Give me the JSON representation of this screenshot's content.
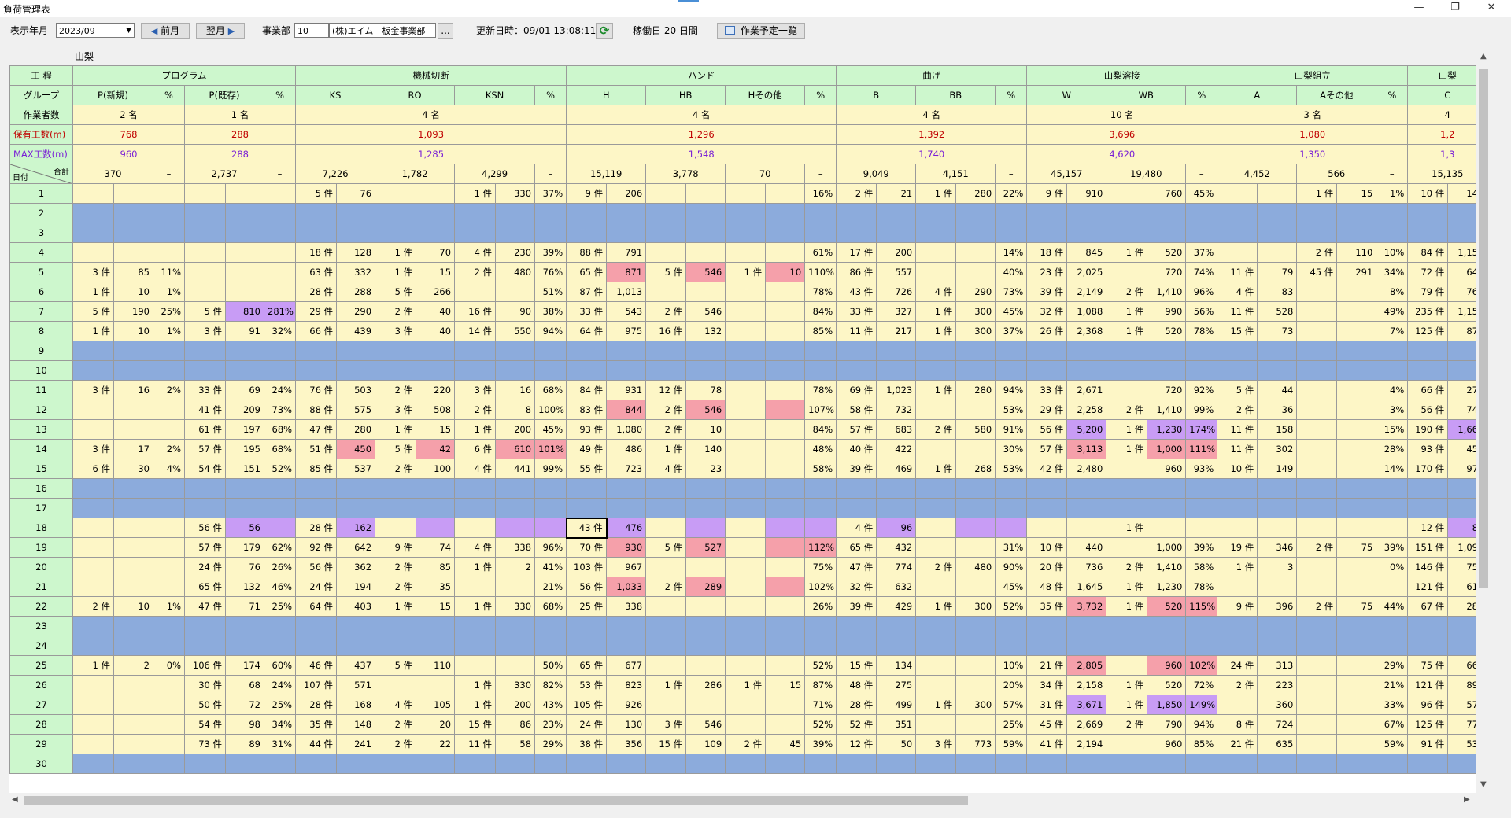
{
  "window": {
    "title": "負荷管理表",
    "btn_minimize": "—",
    "btn_maximize": "❐",
    "btn_close": "✕"
  },
  "toolbar": {
    "year_month_label": "表示年月",
    "year_month_value": "2023/09",
    "calendar_arrow": "▼",
    "prev_arrow": "◀",
    "prev_label": "前月",
    "next_label": "翌月",
    "next_arrow": "▶",
    "division_label": "事業部",
    "division_code": "10",
    "division_name": "(株)エイム　板金事業部",
    "browse_label": "...",
    "updated_label": "更新日時：09/01 13:08:11",
    "refresh_glyph": "⟳",
    "workdays_label": "稼働日 20 日間",
    "schedule_label": "作業予定一覧"
  },
  "subtitle": "山梨",
  "labels": {
    "process": "工 程",
    "group": "グループ",
    "workers": "作業者数",
    "held": "保有工数(m)",
    "max": "MAX工数(m)",
    "date": "日付",
    "total": "合計"
  },
  "processes": [
    {
      "name": "プログラム",
      "span": 6
    },
    {
      "name": "機械切断",
      "span": 7
    },
    {
      "name": "ハンド",
      "span": 7
    },
    {
      "name": "曲げ",
      "span": 5
    },
    {
      "name": "山梨溶接",
      "span": 5
    },
    {
      "name": "山梨組立",
      "span": 5
    },
    {
      "name": "山梨",
      "span": 2
    }
  ],
  "groups": [
    {
      "name": "P(新規)",
      "span": 2
    },
    {
      "name": "%",
      "span": 1
    },
    {
      "name": "P(既存)",
      "span": 2
    },
    {
      "name": "%",
      "span": 1
    },
    {
      "name": "KS",
      "span": 2
    },
    {
      "name": "RO",
      "span": 2
    },
    {
      "name": "KSN",
      "span": 2
    },
    {
      "name": "%",
      "span": 1
    },
    {
      "name": "H",
      "span": 2
    },
    {
      "name": "HB",
      "span": 2
    },
    {
      "name": "Hその他",
      "span": 2
    },
    {
      "name": "%",
      "span": 1
    },
    {
      "name": "B",
      "span": 2
    },
    {
      "name": "BB",
      "span": 2
    },
    {
      "name": "%",
      "span": 1
    },
    {
      "name": "W",
      "span": 2
    },
    {
      "name": "WB",
      "span": 2
    },
    {
      "name": "%",
      "span": 1
    },
    {
      "name": "A",
      "span": 2
    },
    {
      "name": "Aその他",
      "span": 2
    },
    {
      "name": "%",
      "span": 1
    },
    {
      "name": "C",
      "span": 2
    }
  ],
  "workers": [
    {
      "v": "2 名",
      "span": 3
    },
    {
      "v": "1 名",
      "span": 3
    },
    {
      "v": "4 名",
      "span": 7
    },
    {
      "v": "4 名",
      "span": 7
    },
    {
      "v": "4 名",
      "span": 5
    },
    {
      "v": "10 名",
      "span": 5
    },
    {
      "v": "3 名",
      "span": 5
    },
    {
      "v": "4",
      "span": 2
    }
  ],
  "held": [
    {
      "v": "768",
      "span": 3
    },
    {
      "v": "288",
      "span": 3
    },
    {
      "v": "1,093",
      "span": 7
    },
    {
      "v": "1,296",
      "span": 7
    },
    {
      "v": "1,392",
      "span": 5
    },
    {
      "v": "3,696",
      "span": 5
    },
    {
      "v": "1,080",
      "span": 5
    },
    {
      "v": "1,2",
      "span": 2
    }
  ],
  "max": [
    {
      "v": "960",
      "span": 3
    },
    {
      "v": "288",
      "span": 3
    },
    {
      "v": "1,285",
      "span": 7
    },
    {
      "v": "1,548",
      "span": 7
    },
    {
      "v": "1,740",
      "span": 5
    },
    {
      "v": "4,620",
      "span": 5
    },
    {
      "v": "1,350",
      "span": 5
    },
    {
      "v": "1,3",
      "span": 2
    }
  ],
  "totals": [
    {
      "v": "370",
      "span": 2
    },
    {
      "v": "–",
      "span": 1
    },
    {
      "v": "2,737",
      "span": 2
    },
    {
      "v": "–",
      "span": 1
    },
    {
      "v": "7,226",
      "span": 2
    },
    {
      "v": "1,782",
      "span": 2
    },
    {
      "v": "4,299",
      "span": 2
    },
    {
      "v": "–",
      "span": 1
    },
    {
      "v": "15,119",
      "span": 2
    },
    {
      "v": "3,778",
      "span": 2
    },
    {
      "v": "70",
      "span": 2
    },
    {
      "v": "–",
      "span": 1
    },
    {
      "v": "9,049",
      "span": 2
    },
    {
      "v": "4,151",
      "span": 2
    },
    {
      "v": "–",
      "span": 1
    },
    {
      "v": "45,157",
      "span": 2
    },
    {
      "v": "19,480",
      "span": 2
    },
    {
      "v": "–",
      "span": 1
    },
    {
      "v": "4,452",
      "span": 2
    },
    {
      "v": "566",
      "span": 2
    },
    {
      "v": "–",
      "span": 1
    },
    {
      "v": "15,135",
      "span": 2
    }
  ],
  "rows": [
    {
      "day": "1",
      "cells": [
        "",
        "",
        "",
        "",
        "",
        "",
        "5 件",
        "76",
        "",
        "",
        "1 件",
        "330",
        "37%",
        "9 件",
        "206",
        "",
        "",
        "",
        "",
        "16%",
        "2 件",
        "21",
        "1 件",
        "280",
        "22%",
        "9 件",
        "910",
        "",
        "760",
        "45%",
        "",
        "",
        "1 件",
        "15",
        "1%",
        "10 件",
        "145"
      ]
    },
    {
      "day": "2",
      "holiday": true
    },
    {
      "day": "3",
      "holiday": true
    },
    {
      "day": "4",
      "cells": [
        "",
        "",
        "",
        "",
        "",
        "",
        "18 件",
        "128",
        "1 件",
        "70",
        "4 件",
        "230",
        "39%",
        "88 件",
        "791",
        "",
        "",
        "",
        "",
        "61%",
        "17 件",
        "200",
        "",
        "",
        "14%",
        "18 件",
        "845",
        "1 件",
        "520",
        "37%",
        "",
        "",
        "2 件",
        "110",
        "10%",
        "84 件",
        "1,151"
      ]
    },
    {
      "day": "5",
      "cells": [
        "3 件",
        "85",
        "11%",
        "",
        "",
        "",
        "63 件",
        "332",
        "1 件",
        "15",
        "2 件",
        "480",
        "76%",
        "65 件",
        "871",
        "5 件",
        "546",
        "1 件",
        "10",
        "110%",
        "86 件",
        "557",
        "",
        "",
        "40%",
        "23 件",
        "2,025",
        "",
        "720",
        "74%",
        "11 件",
        "79",
        "45 件",
        "291",
        "34%",
        "72 件",
        "644"
      ],
      "pink": [
        14,
        16,
        18
      ]
    },
    {
      "day": "6",
      "cells": [
        "1 件",
        "10",
        "1%",
        "",
        "",
        "",
        "28 件",
        "288",
        "5 件",
        "266",
        "",
        "",
        "51%",
        "87 件",
        "1,013",
        "",
        "",
        "",
        "",
        "78%",
        "43 件",
        "726",
        "4 件",
        "290",
        "73%",
        "39 件",
        "2,149",
        "2 件",
        "1,410",
        "96%",
        "4 件",
        "83",
        "",
        "",
        "8%",
        "79 件",
        "763"
      ]
    },
    {
      "day": "7",
      "cells": [
        "5 件",
        "190",
        "25%",
        "5 件",
        "810",
        "281%",
        "29 件",
        "290",
        "2 件",
        "40",
        "16 件",
        "90",
        "38%",
        "33 件",
        "543",
        "2 件",
        "546",
        "",
        "",
        "84%",
        "33 件",
        "327",
        "1 件",
        "300",
        "45%",
        "32 件",
        "1,088",
        "1 件",
        "990",
        "56%",
        "11 件",
        "528",
        "",
        "",
        "49%",
        "235 件",
        "1,154"
      ],
      "purple": [
        4,
        5
      ]
    },
    {
      "day": "8",
      "cells": [
        "1 件",
        "10",
        "1%",
        "3 件",
        "91",
        "32%",
        "66 件",
        "439",
        "3 件",
        "40",
        "14 件",
        "550",
        "94%",
        "64 件",
        "975",
        "16 件",
        "132",
        "",
        "",
        "85%",
        "11 件",
        "217",
        "1 件",
        "300",
        "37%",
        "26 件",
        "2,368",
        "1 件",
        "520",
        "78%",
        "15 件",
        "73",
        "",
        "",
        "7%",
        "125 件",
        "876"
      ]
    },
    {
      "day": "9",
      "holiday": true
    },
    {
      "day": "10",
      "holiday": true
    },
    {
      "day": "11",
      "cells": [
        "3 件",
        "16",
        "2%",
        "33 件",
        "69",
        "24%",
        "76 件",
        "503",
        "2 件",
        "220",
        "3 件",
        "16",
        "68%",
        "84 件",
        "931",
        "12 件",
        "78",
        "",
        "",
        "78%",
        "69 件",
        "1,023",
        "1 件",
        "280",
        "94%",
        "33 件",
        "2,671",
        "",
        "720",
        "92%",
        "5 件",
        "44",
        "",
        "",
        "4%",
        "66 件",
        "277"
      ]
    },
    {
      "day": "12",
      "cells": [
        "",
        "",
        "",
        "41 件",
        "209",
        "73%",
        "88 件",
        "575",
        "3 件",
        "508",
        "2 件",
        "8",
        "100%",
        "83 件",
        "844",
        "2 件",
        "546",
        "",
        "",
        "107%",
        "58 件",
        "732",
        "",
        "",
        "53%",
        "29 件",
        "2,258",
        "2 件",
        "1,410",
        "99%",
        "2 件",
        "36",
        "",
        "",
        "3%",
        "56 件",
        "744"
      ],
      "pink": [
        14,
        16,
        18
      ]
    },
    {
      "day": "13",
      "cells": [
        "",
        "",
        "",
        "61 件",
        "197",
        "68%",
        "47 件",
        "280",
        "1 件",
        "15",
        "1 件",
        "200",
        "45%",
        "93 件",
        "1,080",
        "2 件",
        "10",
        "",
        "",
        "84%",
        "57 件",
        "683",
        "2 件",
        "580",
        "91%",
        "56 件",
        "5,200",
        "1 件",
        "1,230",
        "174%",
        "11 件",
        "158",
        "",
        "",
        "15%",
        "190 件",
        "1,669"
      ],
      "purple": [
        26,
        28,
        29,
        36
      ]
    },
    {
      "day": "14",
      "cells": [
        "3 件",
        "17",
        "2%",
        "57 件",
        "195",
        "68%",
        "51 件",
        "450",
        "5 件",
        "42",
        "6 件",
        "610",
        "101%",
        "49 件",
        "486",
        "1 件",
        "140",
        "",
        "",
        "48%",
        "40 件",
        "422",
        "",
        "",
        "30%",
        "57 件",
        "3,113",
        "1 件",
        "1,000",
        "111%",
        "11 件",
        "302",
        "",
        "",
        "28%",
        "93 件",
        "453"
      ],
      "pink": [
        7,
        9,
        11,
        12,
        26,
        28,
        29
      ]
    },
    {
      "day": "15",
      "cells": [
        "6 件",
        "30",
        "4%",
        "54 件",
        "151",
        "52%",
        "85 件",
        "537",
        "2 件",
        "100",
        "4 件",
        "441",
        "99%",
        "55 件",
        "723",
        "4 件",
        "23",
        "",
        "",
        "58%",
        "39 件",
        "469",
        "1 件",
        "268",
        "53%",
        "42 件",
        "2,480",
        "",
        "960",
        "93%",
        "10 件",
        "149",
        "",
        "",
        "14%",
        "170 件",
        "974"
      ]
    },
    {
      "day": "16",
      "holiday": true
    },
    {
      "day": "17",
      "holiday": true
    },
    {
      "day": "18",
      "cells": [
        "",
        "",
        "",
        "56 件",
        "56",
        "",
        "28 件",
        "162",
        "",
        "",
        "",
        "",
        "",
        "43 件",
        "476",
        "",
        "",
        "",
        "",
        "",
        "4 件",
        "96",
        "",
        "",
        "",
        "",
        "",
        "1 件",
        "",
        "",
        "",
        "",
        "",
        "",
        "",
        "12 件",
        "84"
      ],
      "purple": [
        4,
        5,
        7,
        9,
        11,
        12,
        14,
        16,
        18,
        19,
        21,
        23,
        24,
        36
      ],
      "sel": 13
    },
    {
      "day": "19",
      "cells": [
        "",
        "",
        "",
        "57 件",
        "179",
        "62%",
        "92 件",
        "642",
        "9 件",
        "74",
        "4 件",
        "338",
        "96%",
        "70 件",
        "930",
        "5 件",
        "527",
        "",
        "",
        "112%",
        "65 件",
        "432",
        "",
        "",
        "31%",
        "10 件",
        "440",
        "",
        "1,000",
        "39%",
        "19 件",
        "346",
        "2 件",
        "75",
        "39%",
        "151 件",
        "1,097"
      ],
      "pink": [
        14,
        16,
        18,
        19
      ]
    },
    {
      "day": "20",
      "cells": [
        "",
        "",
        "",
        "24 件",
        "76",
        "26%",
        "56 件",
        "362",
        "2 件",
        "85",
        "1 件",
        "2",
        "41%",
        "103 件",
        "967",
        "",
        "",
        "",
        "",
        "75%",
        "47 件",
        "774",
        "2 件",
        "480",
        "90%",
        "20 件",
        "736",
        "2 件",
        "1,410",
        "58%",
        "1 件",
        "3",
        "",
        "",
        "0%",
        "146 件",
        "755"
      ]
    },
    {
      "day": "21",
      "cells": [
        "",
        "",
        "",
        "65 件",
        "132",
        "46%",
        "24 件",
        "194",
        "2 件",
        "35",
        "",
        "",
        "21%",
        "56 件",
        "1,033",
        "2 件",
        "289",
        "",
        "",
        "102%",
        "32 件",
        "632",
        "",
        "",
        "45%",
        "48 件",
        "1,645",
        "1 件",
        "1,230",
        "78%",
        "",
        "",
        "",
        "",
        "",
        "121 件",
        "618"
      ],
      "pink": [
        14,
        16,
        18
      ]
    },
    {
      "day": "22",
      "cells": [
        "2 件",
        "10",
        "1%",
        "47 件",
        "71",
        "25%",
        "64 件",
        "403",
        "1 件",
        "15",
        "1 件",
        "330",
        "68%",
        "25 件",
        "338",
        "",
        "",
        "",
        "",
        "26%",
        "39 件",
        "429",
        "1 件",
        "300",
        "52%",
        "35 件",
        "3,732",
        "1 件",
        "520",
        "115%",
        "9 件",
        "396",
        "2 件",
        "75",
        "44%",
        "67 件",
        "286"
      ],
      "pink": [
        26,
        28,
        29
      ]
    },
    {
      "day": "23",
      "holiday": true
    },
    {
      "day": "24",
      "holiday": true
    },
    {
      "day": "25",
      "cells": [
        "1 件",
        "2",
        "0%",
        "106 件",
        "174",
        "60%",
        "46 件",
        "437",
        "5 件",
        "110",
        "",
        "",
        "50%",
        "65 件",
        "677",
        "",
        "",
        "",
        "",
        "52%",
        "15 件",
        "134",
        "",
        "",
        "10%",
        "21 件",
        "2,805",
        "",
        "960",
        "102%",
        "24 件",
        "313",
        "",
        "",
        "29%",
        "75 件",
        "660"
      ],
      "pink": [
        26,
        28,
        29
      ]
    },
    {
      "day": "26",
      "cells": [
        "",
        "",
        "",
        "30 件",
        "68",
        "24%",
        "107 件",
        "571",
        "",
        "",
        "1 件",
        "330",
        "82%",
        "53 件",
        "823",
        "1 件",
        "286",
        "1 件",
        "15",
        "87%",
        "48 件",
        "275",
        "",
        "",
        "20%",
        "34 件",
        "2,158",
        "1 件",
        "520",
        "72%",
        "2 件",
        "223",
        "",
        "",
        "21%",
        "121 件",
        "899"
      ]
    },
    {
      "day": "27",
      "cells": [
        "",
        "",
        "",
        "50 件",
        "72",
        "25%",
        "28 件",
        "168",
        "4 件",
        "105",
        "1 件",
        "200",
        "43%",
        "105 件",
        "926",
        "",
        "",
        "",
        "",
        "71%",
        "28 件",
        "499",
        "1 件",
        "300",
        "57%",
        "31 件",
        "3,671",
        "1 件",
        "1,850",
        "149%",
        "",
        "360",
        "",
        "",
        "33%",
        "96 件",
        "575"
      ],
      "purple": [
        26,
        28,
        29
      ]
    },
    {
      "day": "28",
      "cells": [
        "",
        "",
        "",
        "54 件",
        "98",
        "34%",
        "35 件",
        "148",
        "2 件",
        "20",
        "15 件",
        "86",
        "23%",
        "24 件",
        "130",
        "3 件",
        "546",
        "",
        "",
        "52%",
        "52 件",
        "351",
        "",
        "",
        "25%",
        "45 件",
        "2,669",
        "2 件",
        "790",
        "94%",
        "8 件",
        "724",
        "",
        "",
        "67%",
        "125 件",
        "773"
      ]
    },
    {
      "day": "29",
      "cells": [
        "",
        "",
        "",
        "73 件",
        "89",
        "31%",
        "44 件",
        "241",
        "2 件",
        "22",
        "11 件",
        "58",
        "29%",
        "38 件",
        "356",
        "15 件",
        "109",
        "2 件",
        "45",
        "39%",
        "12 件",
        "50",
        "3 件",
        "773",
        "59%",
        "41 件",
        "2,194",
        "",
        "960",
        "85%",
        "21 件",
        "635",
        "",
        "",
        "59%",
        "91 件",
        "538"
      ]
    },
    {
      "day": "30",
      "holiday": true
    }
  ]
}
